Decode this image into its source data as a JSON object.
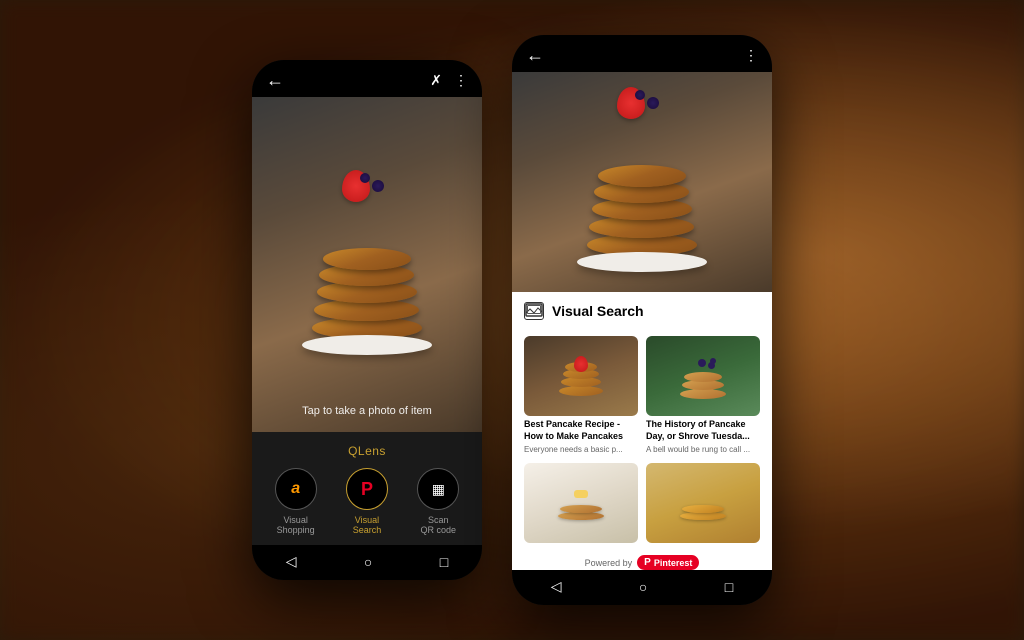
{
  "background": {
    "color": "#2a1a0a"
  },
  "phone_left": {
    "top_bar": {
      "back_arrow": "←",
      "icons": [
        "✗",
        "⋮"
      ]
    },
    "tap_text": "Tap to take a photo of item",
    "qlens": {
      "title": "QLens",
      "items": [
        {
          "id": "visual-shopping",
          "label": "Visual\nShopping",
          "active": false
        },
        {
          "id": "visual-search",
          "label": "Visual\nSearch",
          "active": true
        },
        {
          "id": "scan-qr",
          "label": "Scan\nQR code",
          "active": false
        }
      ]
    },
    "nav_bar": {
      "back": "◁",
      "home": "○",
      "recents": "□"
    }
  },
  "phone_right": {
    "top_bar": {
      "back_arrow": "←",
      "icons": [
        "⋮"
      ]
    },
    "visual_search": {
      "title": "Visual Search",
      "results": [
        {
          "id": "result-1",
          "title": "Best Pancake Recipe - How to Make Pancakes",
          "description": "Everyone needs a basic p..."
        },
        {
          "id": "result-2",
          "title": "The History of Pancake Day, or Shrove Tuesda...",
          "description": "A bell would be rung to call ..."
        },
        {
          "id": "result-3",
          "title": "",
          "description": ""
        },
        {
          "id": "result-4",
          "title": "",
          "description": ""
        }
      ],
      "powered_by": "Powered by",
      "pinterest_label": "Pinterest"
    },
    "nav_bar": {
      "back": "◁",
      "home": "○",
      "recents": "□"
    }
  }
}
